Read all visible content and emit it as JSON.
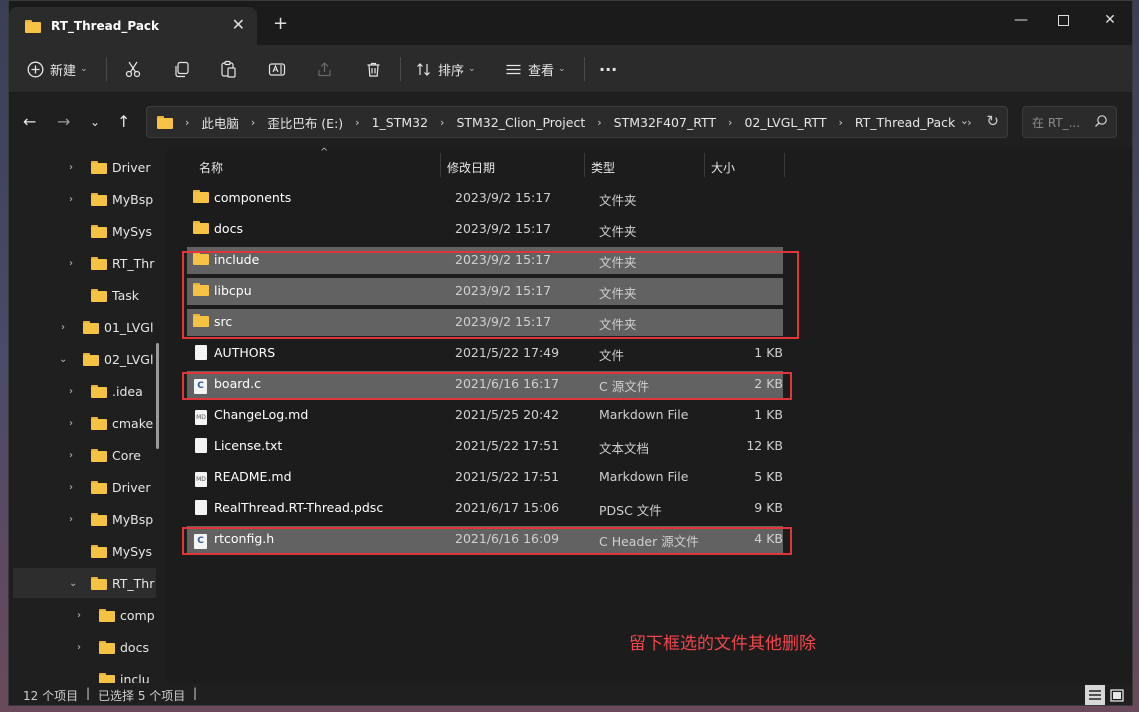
{
  "window": {
    "tab_title": "RT_Thread_Pack",
    "new_tab": "+",
    "tab_close": "✕",
    "minimize": "—",
    "close": "✕"
  },
  "toolbar": {
    "new_label": "新建",
    "sort_label": "排序",
    "view_label": "查看",
    "more": "···"
  },
  "breadcrumb": [
    "此电脑",
    "歪比巴布 (E:)",
    "1_STM32",
    "STM32_Clion_Project",
    "STM32F407_RTT",
    "02_LVGL_RTT",
    "RT_Thread_Pack"
  ],
  "search": {
    "placeholder": "在 RT_..."
  },
  "sidebar": {
    "items": [
      {
        "label": "Driver",
        "expandable": true
      },
      {
        "label": "MyBsp",
        "expandable": true
      },
      {
        "label": "MySys",
        "expandable": false
      },
      {
        "label": "RT_Thr",
        "expandable": true
      },
      {
        "label": "Task",
        "expandable": false
      },
      {
        "label": "01_LVGl",
        "expandable": true
      },
      {
        "label": "02_LVGl",
        "expandable": true,
        "expanded": true
      },
      {
        "label": ".idea",
        "expandable": true
      },
      {
        "label": "cmake",
        "expandable": true
      },
      {
        "label": "Core",
        "expandable": true
      },
      {
        "label": "Driver",
        "expandable": true
      },
      {
        "label": "MyBsp",
        "expandable": true
      },
      {
        "label": "MySys",
        "expandable": false
      },
      {
        "label": "RT_Thr",
        "expandable": true,
        "expanded": true,
        "selected": true
      },
      {
        "label": "comp",
        "expandable": true
      },
      {
        "label": "docs",
        "expandable": true
      },
      {
        "label": "inclu",
        "expandable": false
      }
    ]
  },
  "columns": {
    "name": "名称",
    "date": "修改日期",
    "type": "类型",
    "size": "大小"
  },
  "files": [
    {
      "name": "components",
      "date": "2023/9/2 15:17",
      "type": "文件夹",
      "size": "",
      "icon": "folder-icon",
      "selected": false
    },
    {
      "name": "docs",
      "date": "2023/9/2 15:17",
      "type": "文件夹",
      "size": "",
      "icon": "folder-icon",
      "selected": false
    },
    {
      "name": "include",
      "date": "2023/9/2 15:17",
      "type": "文件夹",
      "size": "",
      "icon": "folder-icon",
      "selected": true
    },
    {
      "name": "libcpu",
      "date": "2023/9/2 15:17",
      "type": "文件夹",
      "size": "",
      "icon": "folder-icon",
      "selected": true
    },
    {
      "name": "src",
      "date": "2023/9/2 15:17",
      "type": "文件夹",
      "size": "",
      "icon": "folder-icon",
      "selected": true
    },
    {
      "name": "AUTHORS",
      "date": "2021/5/22 17:49",
      "type": "文件",
      "size": "1 KB",
      "icon": "file-icon",
      "selected": false
    },
    {
      "name": "board.c",
      "date": "2021/6/16 16:17",
      "type": "C 源文件",
      "size": "2 KB",
      "icon": "c-file-icon",
      "selected": true
    },
    {
      "name": "ChangeLog.md",
      "date": "2021/5/25 20:42",
      "type": "Markdown File",
      "size": "1 KB",
      "icon": "markdown-file-icon",
      "selected": false
    },
    {
      "name": "License.txt",
      "date": "2021/5/22 17:51",
      "type": "文本文档",
      "size": "12 KB",
      "icon": "text-file-icon",
      "selected": false
    },
    {
      "name": "README.md",
      "date": "2021/5/22 17:51",
      "type": "Markdown File",
      "size": "5 KB",
      "icon": "markdown-file-icon",
      "selected": false
    },
    {
      "name": "RealThread.RT-Thread.pdsc",
      "date": "2021/6/17 15:06",
      "type": "PDSC 文件",
      "size": "9 KB",
      "icon": "file-icon",
      "selected": false
    },
    {
      "name": "rtconfig.h",
      "date": "2021/6/16 16:09",
      "type": "C Header 源文件",
      "size": "4 KB",
      "icon": "c-file-icon",
      "selected": true
    }
  ],
  "annotation": "留下框选的文件其他删除",
  "status": {
    "count": "12 个项目",
    "selected": "已选择 5 个项目",
    "divider": "|"
  },
  "colors": {
    "annotation_red": "#e0353b",
    "selected_row": "#626262",
    "folder_yellow": "#f6c244"
  }
}
